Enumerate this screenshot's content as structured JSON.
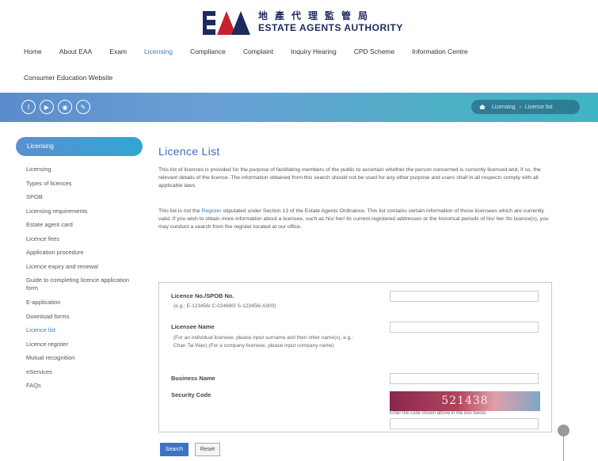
{
  "header": {
    "logo_cn": "地產代理監管局",
    "logo_en": "ESTATE AGENTS AUTHORITY"
  },
  "nav": {
    "items": [
      "Home",
      "About EAA",
      "Exam",
      "Licensing",
      "Compliance",
      "Complaint",
      "Inquiry Hearing",
      "CPD Scheme",
      "Information Centre"
    ],
    "second_row": "Consumer Education Website",
    "active": "Licensing"
  },
  "banner": {
    "icons": [
      "facebook-icon",
      "youtube-icon",
      "instagram-icon",
      "link-icon"
    ],
    "breadcrumb": [
      "Licensing",
      "›",
      "Licence list"
    ]
  },
  "sidebar": {
    "heading": "Licensing",
    "items": [
      "Licensing",
      "Types of licences",
      "SPOB",
      "Licensing requirements",
      "Estate agent card",
      "Licence fees",
      "Application procedure",
      "Licence expiry and renewal",
      "Guide to completing licence application form",
      "E-application",
      "Download forms",
      "Licence list",
      "Licence register",
      "Mutual recognition",
      "eServices",
      "FAQs"
    ],
    "current": "Licence list"
  },
  "main": {
    "title": "Licence List",
    "para1": "This list of licences is provided for the purpose of facilitating members of the public to ascertain whether the person concerned is currently licensed and, if so, the relevant details of the licence. The information obtained from this search should not be used for any other purpose and users shall in all respects comply with all applicable laws.",
    "para2_pre": "This list is not the ",
    "para2_link": "Register",
    "para2_post": " stipulated under Section 13 of the Estate Agents Ordinance. This list contains certain information of those licensees which are currently valid. If you wish to obtain more information about a licensee, such as his/ her/ its current registered addresses or the historical periods of his/ her /its licence(s), you may conduct a search from the register located at our office."
  },
  "form": {
    "licence_label": "Licence No./SPOB No.",
    "licence_hint": "(e.g.: E-123456/ C-024680/ S-123456/ A000)",
    "licensee_label": "Licensee Name",
    "licensee_hint": "(For an individual licensee, please input surname and then other name(s), e.g.: Chan Tai Wan) (For a company licensee, please input company name)",
    "business_label": "Business Name",
    "security_label": "Security Code",
    "captcha_code": "521438",
    "captcha_note": "Enter the code shown above in the box below.",
    "search_button": "Search",
    "reset_button": "Reset"
  }
}
